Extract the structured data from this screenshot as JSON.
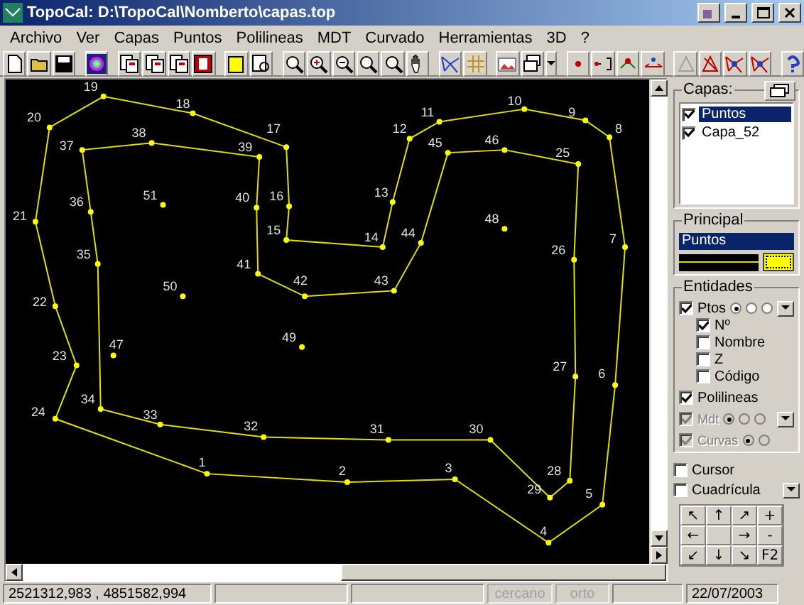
{
  "window": {
    "title": "TopoCal: D:\\TopoCal\\Nomberto\\capas.top"
  },
  "menu": [
    "Archivo",
    "Ver",
    "Capas",
    "Puntos",
    "Polilineas",
    "MDT",
    "Curvado",
    "Herramientas",
    "3D",
    "?"
  ],
  "map": {
    "points": [
      {
        "label": "19"
      },
      {
        "label": "18"
      },
      {
        "label": "10"
      },
      {
        "label": "20"
      },
      {
        "label": "11"
      },
      {
        "label": "9"
      },
      {
        "label": "38"
      },
      {
        "label": "17"
      },
      {
        "label": "12"
      },
      {
        "label": "8"
      },
      {
        "label": "37"
      },
      {
        "label": "39"
      },
      {
        "label": "45"
      },
      {
        "label": "46"
      },
      {
        "label": "25"
      },
      {
        "label": "36"
      },
      {
        "label": "51"
      },
      {
        "label": "40"
      },
      {
        "label": "16"
      },
      {
        "label": "13"
      },
      {
        "label": "21"
      },
      {
        "label": "48"
      },
      {
        "label": "15"
      },
      {
        "label": "14"
      },
      {
        "label": "44"
      },
      {
        "label": "7"
      },
      {
        "label": "35"
      },
      {
        "label": "26"
      },
      {
        "label": "41"
      },
      {
        "label": "50"
      },
      {
        "label": "42"
      },
      {
        "label": "43"
      },
      {
        "label": "22"
      },
      {
        "label": "47"
      },
      {
        "label": "49"
      },
      {
        "label": "23"
      },
      {
        "label": "27"
      },
      {
        "label": "6"
      },
      {
        "label": "34"
      },
      {
        "label": "24"
      },
      {
        "label": "33"
      },
      {
        "label": "32"
      },
      {
        "label": "31"
      },
      {
        "label": "30"
      },
      {
        "label": "1"
      },
      {
        "label": "2"
      },
      {
        "label": "3"
      },
      {
        "label": "28"
      },
      {
        "label": "29"
      },
      {
        "label": "5"
      },
      {
        "label": "4"
      }
    ]
  },
  "layers_panel": {
    "title": "Capas:",
    "layers": [
      {
        "name": "Puntos",
        "checked": true,
        "selected": true
      },
      {
        "name": "Capa_52",
        "checked": true,
        "selected": false
      }
    ]
  },
  "principal": {
    "title": "Principal",
    "layer": "Puntos"
  },
  "entities": {
    "title": "Entidades",
    "rows": [
      {
        "kind": "radio",
        "label": "Ptos",
        "checked": true,
        "disabled": false,
        "radios": [
          {
            "selected": true
          },
          {
            "selected": false
          },
          {
            "selected": false
          }
        ]
      },
      {
        "kind": "sub",
        "label": "Nº",
        "checked": true,
        "disabled": false
      },
      {
        "kind": "sub",
        "label": "Nombre",
        "checked": false,
        "disabled": false
      },
      {
        "kind": "sub",
        "label": "Z",
        "checked": false,
        "disabled": false
      },
      {
        "kind": "sub",
        "label": "Código",
        "checked": false,
        "disabled": false
      },
      {
        "kind": "plain",
        "label": "Polilineas",
        "checked": true,
        "disabled": false
      },
      {
        "kind": "radio",
        "label": "Mdt",
        "checked": true,
        "disabled": true,
        "radios": [
          {
            "selected": true
          },
          {
            "selected": false
          },
          {
            "selected": false
          }
        ]
      },
      {
        "kind": "radio2",
        "label": "Curvas",
        "checked": true,
        "disabled": true,
        "radios": [
          {
            "selected": true
          },
          {
            "selected": false
          }
        ]
      }
    ]
  },
  "options": [
    {
      "label": "Cursor",
      "checked": false,
      "dropdown": false
    },
    {
      "label": "Cuadrícula",
      "checked": false,
      "dropdown": true
    }
  ],
  "nav_pad": [
    {
      "kind": "key",
      "label": "↖"
    },
    {
      "kind": "key",
      "label": "↑"
    },
    {
      "kind": "key",
      "label": "↗"
    },
    {
      "kind": "key",
      "label": "+"
    },
    {
      "kind": "key",
      "label": "←"
    },
    {
      "kind": "blank"
    },
    {
      "kind": "key",
      "label": "→"
    },
    {
      "kind": "key",
      "label": "-"
    },
    {
      "kind": "key",
      "label": "↙"
    },
    {
      "kind": "key",
      "label": "↓"
    },
    {
      "kind": "key",
      "label": "↘"
    },
    {
      "kind": "key",
      "label": "F2"
    }
  ],
  "status_bar": [
    {
      "text": "2521312,983 , 4851582,994",
      "disabled": false
    },
    {
      "disabled": false
    },
    {
      "disabled": false
    },
    {
      "text": "cercano",
      "disabled": true
    },
    {
      "text": "orto",
      "disabled": true
    },
    {
      "disabled": false
    },
    {
      "text": "22/07/2003",
      "disabled": false
    }
  ]
}
